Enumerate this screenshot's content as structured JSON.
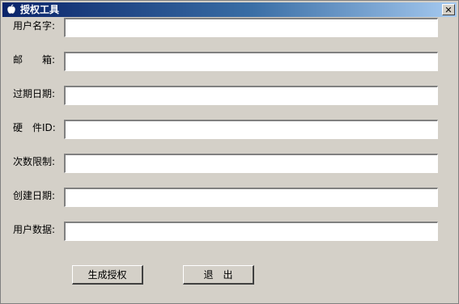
{
  "window": {
    "title": "授权工具",
    "app_icon": "apple-icon",
    "close_glyph": "✕"
  },
  "fields": [
    {
      "key": "username",
      "label": "用户名字:",
      "value": ""
    },
    {
      "key": "email",
      "label": "邮　　箱:",
      "value": ""
    },
    {
      "key": "expiry-date",
      "label": "过期日期:",
      "value": ""
    },
    {
      "key": "hardware-id",
      "label": "硬　件ID:",
      "value": ""
    },
    {
      "key": "usage-limit",
      "label": "次数限制:",
      "value": ""
    },
    {
      "key": "created-date",
      "label": "创建日期:",
      "value": ""
    },
    {
      "key": "user-data",
      "label": "用户数据:",
      "value": ""
    }
  ],
  "buttons": {
    "generate": "生成授权",
    "exit": "退　出"
  }
}
